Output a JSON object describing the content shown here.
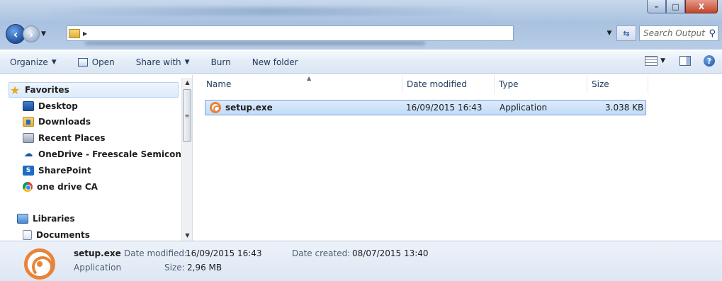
{
  "window": {
    "minimize_glyph": "–",
    "maximize_glyph": "□",
    "close_glyph": "X"
  },
  "address": {
    "search_placeholder": "Search Output"
  },
  "toolbar": {
    "organize": "Organize",
    "open": "Open",
    "share_with": "Share with",
    "burn": "Burn",
    "new_folder": "New folder"
  },
  "nav": {
    "favorites": "Favorites",
    "items": [
      {
        "label": "Desktop",
        "icon": "desktop-icon"
      },
      {
        "label": "Downloads",
        "icon": "downloads-folder-icon"
      },
      {
        "label": "Recent Places",
        "icon": "recent-places-icon"
      },
      {
        "label": "OneDrive - Freescale Semicondu",
        "icon": "onedrive-icon"
      },
      {
        "label": "SharePoint",
        "icon": "sharepoint-icon"
      },
      {
        "label": "one drive CA",
        "icon": "chrome-icon"
      }
    ],
    "libraries": "Libraries",
    "library_items": [
      {
        "label": "Documents",
        "icon": "documents-icon"
      }
    ]
  },
  "columns": {
    "name": "Name",
    "date_modified": "Date modified",
    "type": "Type",
    "size": "Size"
  },
  "files": [
    {
      "name": "setup.exe",
      "date_modified": "16/09/2015 16:43",
      "type": "Application",
      "size": "3.038 KB",
      "selected": true
    }
  ],
  "details": {
    "filename": "setup.exe",
    "filetype": "Application",
    "date_modified_label": "Date modified:",
    "date_modified": "16/09/2015 16:43",
    "size_label": "Size:",
    "size": "2,96 MB",
    "date_created_label": "Date created:",
    "date_created": "08/07/2015 13:40"
  },
  "colors": {
    "accent": "#1e395b",
    "selection": "#c2dcf8",
    "selection_border": "#7da2ce",
    "exe_icon": "#e6843c"
  }
}
